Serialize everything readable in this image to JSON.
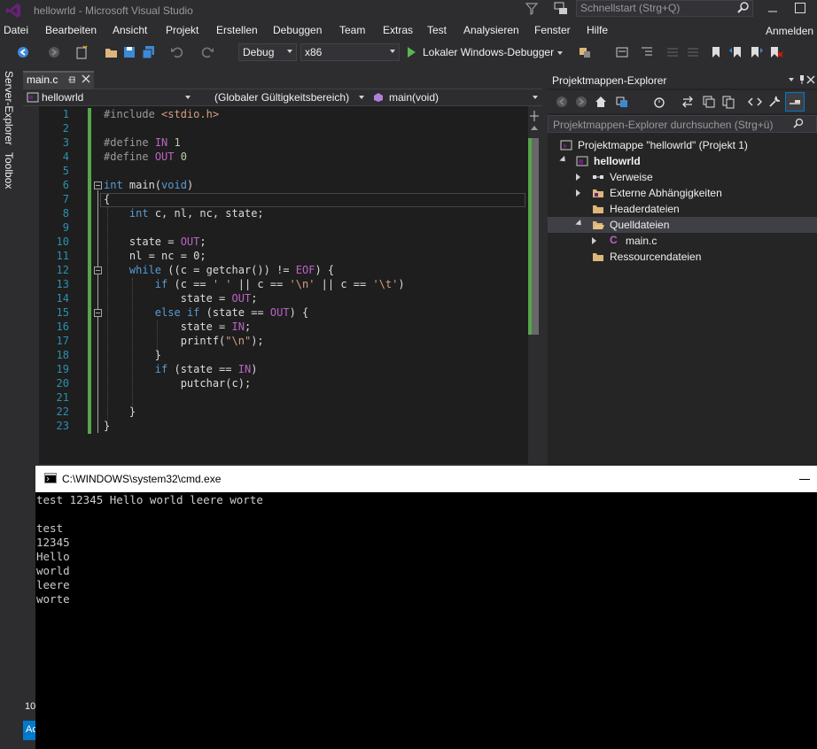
{
  "window": {
    "title": "hellowrld - Microsoft Visual Studio",
    "quick_launch_placeholder": "Schnellstart (Strg+Q)",
    "signin": "Anmelden"
  },
  "menu": [
    "Datei",
    "Bearbeiten",
    "Ansicht",
    "Projekt",
    "Erstellen",
    "Debuggen",
    "Team",
    "Extras",
    "Test",
    "Analysieren",
    "Fenster",
    "Hilfe"
  ],
  "toolbar": {
    "config": "Debug",
    "platform": "x86",
    "run_label": "Lokaler Windows-Debugger"
  },
  "side_tabs": [
    "Server-Explorer",
    "Toolbox"
  ],
  "editor": {
    "tab": "main.c",
    "nav_project": "hellowrld",
    "nav_scope": "(Globaler Gültigkeitsbereich)",
    "nav_member": "main(void)",
    "lines": [
      "#include <stdio.h>",
      "",
      "#define IN 1",
      "#define OUT 0",
      "",
      "int main(void)",
      "{",
      "    int c, nl, nc, state;",
      "",
      "    state = OUT;",
      "    nl = nc = 0;",
      "    while ((c = getchar()) != EOF) {",
      "        if (c == ' ' || c == '\\n' || c == '\\t')",
      "            state = OUT;",
      "        else if (state == OUT) {",
      "            state = IN;",
      "            printf(\"\\n\");",
      "        }",
      "        if (state == IN)",
      "            putchar(c);",
      "",
      "    }",
      "}"
    ]
  },
  "solution_explorer": {
    "title": "Projektmappen-Explorer",
    "search_placeholder": "Projektmappen-Explorer durchsuchen (Strg+ü)",
    "solution": "Projektmappe \"hellowrld\" (Projekt 1)",
    "project": "hellowrld",
    "items": [
      "Verweise",
      "Externe Abhängigkeiten",
      "Headerdateien",
      "Quelldateien",
      "main.c",
      "Ressourcendateien"
    ]
  },
  "console": {
    "title": "C:\\WINDOWS\\system32\\cmd.exe",
    "lines": [
      "test 12345 Hello world leere worte",
      "",
      "test",
      "12345",
      "Hello",
      "world",
      "leere",
      "worte"
    ]
  },
  "statusbar": {
    "num": "10",
    "blue": "Ac"
  },
  "colors": {
    "background": "#2d2d30",
    "editor_bg": "#1e1e1e",
    "keyword": "#569cd6",
    "macro": "#bd63c5",
    "string": "#d69d85",
    "line_number": "#2b91af",
    "accent": "#007acc"
  }
}
